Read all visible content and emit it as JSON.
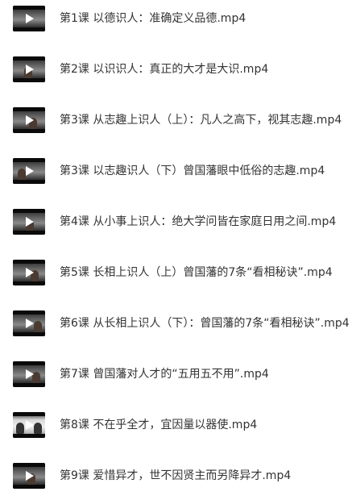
{
  "files": [
    {
      "name": "第1课 以德识人：准确定义品德.mp4",
      "icon": "video-thumbnail-play-icon"
    },
    {
      "name": "第2课 以识识人：真正的大才是大识.mp4",
      "icon": "video-thumbnail-play-icon"
    },
    {
      "name": "第3课 从志趣上识人（上）：凡人之高下，视其志趣.mp4",
      "icon": "video-thumbnail-play-icon"
    },
    {
      "name": "第3课 以志趣识人（下）曾国藩眼中低俗的志趣.mp4",
      "icon": "video-thumbnail-play-icon"
    },
    {
      "name": "第4课 从小事上识人：绝大学问皆在家庭日用之间.mp4",
      "icon": "video-thumbnail-play-icon"
    },
    {
      "name": "第5课 长相上识人（上）曾国藩的7条“看相秘诀”.mp4",
      "icon": "video-thumbnail-play-icon"
    },
    {
      "name": "第6课 从长相上识人（下）：曾国藩的7条“看相秘诀”.mp4",
      "icon": "video-thumbnail-play-icon"
    },
    {
      "name": "第7课 曾国藩对人才的“五用五不用”.mp4",
      "icon": "video-thumbnail-play-icon"
    },
    {
      "name": "第8课 不在乎全才，宜因量以器使.mp4",
      "icon": "video-thumbnail-play-icon"
    },
    {
      "name": "第9课 爱惜异才，世不因贤主而另降异才.mp4",
      "icon": "video-thumbnail-play-icon"
    }
  ],
  "colors": {
    "text": "#333333",
    "background": "#ffffff",
    "play": "#ffffff"
  }
}
